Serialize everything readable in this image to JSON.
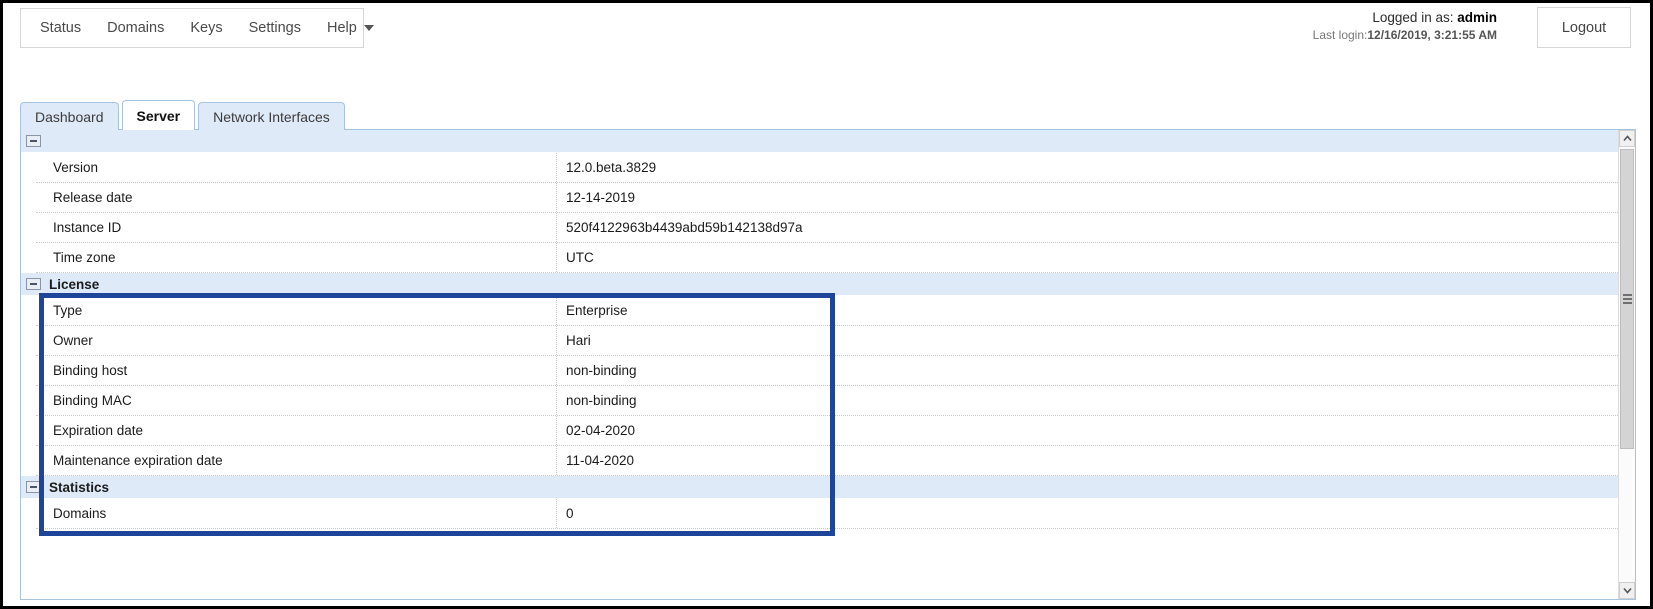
{
  "menu": {
    "items": [
      {
        "label": "Status",
        "has_caret": false,
        "icon": ""
      },
      {
        "label": "Domains",
        "has_caret": false,
        "icon": ""
      },
      {
        "label": "Keys",
        "has_caret": false,
        "icon": ""
      },
      {
        "label": "Settings",
        "has_caret": false,
        "icon": ""
      },
      {
        "label": "Help",
        "has_caret": true,
        "icon": "chevron-down-icon"
      }
    ]
  },
  "session": {
    "logged_in_prefix": "Logged in as:",
    "username": "admin",
    "last_login_prefix": "Last login:",
    "last_login_value": "12/16/2019, 3:21:55 AM",
    "logout_label": "Logout"
  },
  "tabs": [
    {
      "label": "Dashboard",
      "active": false
    },
    {
      "label": "Server",
      "active": true
    },
    {
      "label": "Network Interfaces",
      "active": false
    }
  ],
  "grid": {
    "groups": [
      {
        "title": "",
        "collapse_icon": "minus-box-icon",
        "rows": [
          {
            "label": "Version",
            "value": "12.0.beta.3829"
          },
          {
            "label": "Release date",
            "value": "12-14-2019"
          },
          {
            "label": "Instance ID",
            "value": "520f4122963b4439abd59b142138d97a"
          },
          {
            "label": "Time zone",
            "value": "UTC"
          }
        ]
      },
      {
        "title": "License",
        "collapse_icon": "minus-box-icon",
        "rows": [
          {
            "label": "Type",
            "value": "Enterprise"
          },
          {
            "label": "Owner",
            "value": "Hari"
          },
          {
            "label": "Binding host",
            "value": "non-binding"
          },
          {
            "label": "Binding MAC",
            "value": "non-binding"
          },
          {
            "label": "Expiration date",
            "value": "02-04-2020"
          },
          {
            "label": "Maintenance expiration date",
            "value": "11-04-2020"
          }
        ]
      },
      {
        "title": "Statistics",
        "collapse_icon": "minus-box-icon",
        "rows": [
          {
            "label": "Domains",
            "value": "0"
          }
        ]
      }
    ]
  },
  "annotation": {
    "highlight_color": "#1f459b",
    "target": "License"
  },
  "scrollbar": {
    "up_icon": "chevron-up-icon",
    "down_icon": "chevron-down-icon",
    "grip_icon": "grip-lines-icon"
  },
  "colors": {
    "header_band": "#dfeaf8",
    "panel_border": "#a7c3e0",
    "highlight": "#1f459b",
    "text": "#1b1b1b"
  }
}
